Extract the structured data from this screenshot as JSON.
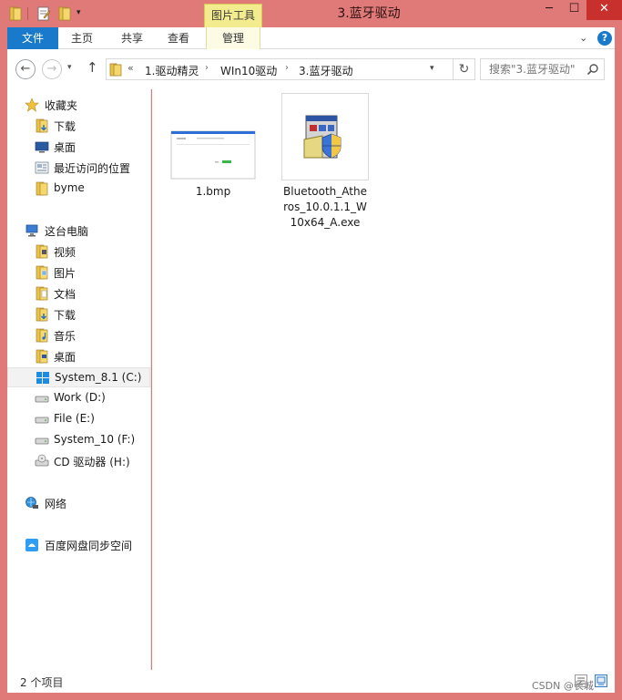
{
  "titlebar": {
    "contextual_tab": "图片工具",
    "title": "3.蓝牙驱动",
    "minimize": "─",
    "maximize": "☐",
    "close": "✕"
  },
  "ribbon": {
    "tabs": [
      "文件",
      "主页",
      "共享",
      "查看",
      "管理"
    ],
    "expand_glyph": "⌄",
    "help_glyph": "?"
  },
  "address": {
    "back_glyph": "←",
    "forward_glyph": "→",
    "up_glyph": "↑",
    "chevron": "«",
    "crumbs": [
      "1.驱动精灵",
      "WIn10驱动",
      "3.蓝牙驱动"
    ],
    "crumb_sep": "›",
    "refresh_glyph": "↻",
    "search_placeholder": "搜索\"3.蓝牙驱动\""
  },
  "nav": {
    "favorites": {
      "label": "收藏夹",
      "items": [
        "下载",
        "桌面",
        "最近访问的位置",
        "byme"
      ]
    },
    "this_pc": {
      "label": "这台电脑",
      "items": [
        "视频",
        "图片",
        "文档",
        "下载",
        "音乐",
        "桌面",
        "System_8.1 (C:)",
        "Work (D:)",
        "File (E:)",
        "System_10 (F:)",
        "CD 驱动器 (H:)"
      ]
    },
    "network": {
      "label": "网络"
    },
    "baidu": {
      "label": "百度网盘同步空间"
    }
  },
  "files": [
    {
      "name": "1.bmp",
      "icon": "bitmap-thumbnail"
    },
    {
      "name": "Bluetooth_Atheros_10.0.1.1_W10x64_A.exe",
      "icon": "installer-shield-icon"
    }
  ],
  "status": {
    "count": "2 个项目",
    "watermark": "CSDN @长城"
  },
  "colors": {
    "window_frame": "#e07a78",
    "close_button": "#c7302c",
    "file_tab": "#1979ca",
    "contextual_tab": "#f3ec8e",
    "folder_yellow": "#e8c24a"
  }
}
